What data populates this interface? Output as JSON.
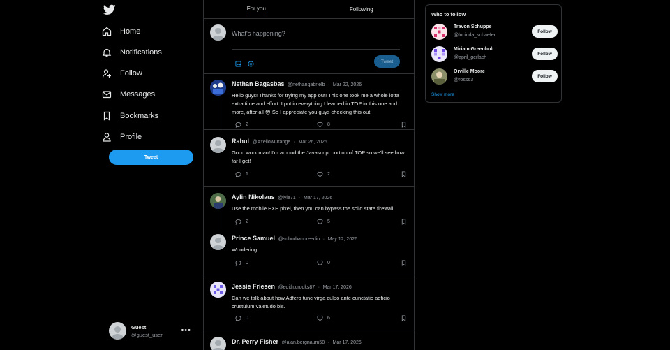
{
  "nav": {
    "items": [
      {
        "label": "Home",
        "icon": "home-icon"
      },
      {
        "label": "Notifications",
        "icon": "bell-icon"
      },
      {
        "label": "Follow",
        "icon": "follow-icon"
      },
      {
        "label": "Messages",
        "icon": "envelope-icon"
      },
      {
        "label": "Bookmarks",
        "icon": "bookmark-icon"
      },
      {
        "label": "Profile",
        "icon": "profile-icon"
      }
    ],
    "tweet_label": "Tweet"
  },
  "guest": {
    "name": "Guest",
    "handle": "@guest_user",
    "more": "•••"
  },
  "tabs": [
    {
      "label": "For you"
    },
    {
      "label": "Following"
    }
  ],
  "composer": {
    "placeholder": "What's happening?",
    "tweet_label": "Tweet"
  },
  "posts": [
    {
      "name": "Nethan Bagasbas",
      "handle": "@nethangabrielb",
      "date": "Mar 22, 2026",
      "text": "Hello guys! Thanks for trying my app out! This one took me a whole lotta extra time and effort. I put in everything I learned in TOP in this one and more, after all 😳 So I appreciate you guys checking this out",
      "replies": "2",
      "likes": "8"
    },
    {
      "name": "Rahul",
      "handle": "@AYellowOrange",
      "date": "Mar 26, 2026",
      "text": "Good work man! I'm around the Javascript portion of TOP so we'll see how far I get!",
      "replies": "1",
      "likes": "2"
    },
    {
      "name": "Aylin Nikolaus",
      "handle": "@lyle71",
      "date": "Mar 17, 2026",
      "text": "Use the mobile EXE pixel, then you can bypass the solid state firewall!",
      "replies": "2",
      "likes": "5"
    },
    {
      "name": "Prince Samuel",
      "handle": "@suburbanbreedin",
      "date": "May 12, 2026",
      "text": "Wondering",
      "replies": "0",
      "likes": "0"
    },
    {
      "name": "Jessie Friesen",
      "handle": "@edith.crooks87",
      "date": "Mar 17, 2026",
      "text": "Can we talk about how Adfero tunc virga culpo ante cunctatio adficio crustulum valetudo bis.",
      "replies": "0",
      "likes": "6"
    },
    {
      "name": "Dr. Perry Fisher",
      "handle": "@alan.bergnaum58",
      "date": "Mar 17, 2026",
      "text": "",
      "replies": "",
      "likes": ""
    }
  ],
  "who_to_follow": {
    "title": "Who to follow",
    "users": [
      {
        "name": "Travon Schuppe",
        "handle": "@lucinda_schaefer",
        "button": "Follow"
      },
      {
        "name": "Miriam Greenholt",
        "handle": "@april_gerlach",
        "button": "Follow"
      },
      {
        "name": "Orville Moore",
        "handle": "@ross63",
        "button": "Follow"
      }
    ],
    "show_more": "Show more"
  },
  "colors": {
    "accent": "#1d9bf0",
    "background": "#000000",
    "border": "#2f3336",
    "muted": "#9aa0a6"
  }
}
